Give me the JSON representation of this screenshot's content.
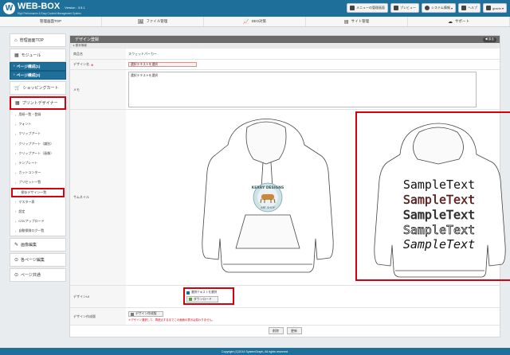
{
  "app": {
    "logo_glyph": "W",
    "name": "WEB-BOX",
    "version": "Version : 3.5.1",
    "tagline": "High Performance & Easy Content Management System"
  },
  "top_buttons": [
    {
      "label": "メニューの管理画面",
      "icon": "monitor-icon"
    },
    {
      "label": "プレビュー",
      "icon": "preview-icon"
    },
    {
      "label": "システム情報",
      "icon": "info-icon"
    },
    {
      "label": "ヘルプ",
      "icon": "help-icon"
    },
    {
      "label": "gravin",
      "icon": "user-icon"
    }
  ],
  "nav": [
    {
      "label": "管理画面TOP",
      "icon": ""
    },
    {
      "label": "ファイル管理",
      "icon": "🖼"
    },
    {
      "label": "SEO対策",
      "icon": "📈"
    },
    {
      "label": "サイト管理",
      "icon": "▤"
    },
    {
      "label": "サポート",
      "icon": "☁"
    }
  ],
  "sidebar": {
    "admin_top": "管理画面TOP",
    "module": "モジュール",
    "page_config_1": "ページ構成(1)",
    "page_config_2": "ページ構成(2)",
    "shopping_cart": "ショッピングカート",
    "print_designer": "プリントデザイナー",
    "sub_items": [
      "用紙一覧・登録",
      "フォント",
      "クリップアート",
      "クリップアート（識別）",
      "クリップアート（画像）",
      "テンプレート",
      "カットコンター",
      "プリセット一覧",
      "保存デザイン一覧",
      "マスター表",
      "設定",
      "CSVアップロード",
      "自動保険ログ一覧"
    ],
    "image_edit": "画像編集",
    "page_edit": "各ページ編集",
    "page_common": "ページ共通"
  },
  "main": {
    "title": "デザイン登録",
    "back_label": "◀ 戻る",
    "subheader": "▸ 基本情報",
    "rows": {
      "product_label": "商品名",
      "product_value": "スウェットパーカー",
      "design_name_label": "デザイン名",
      "required_mark": "※",
      "design_name_value": "選択テキストを選択",
      "memo_label": "メモ",
      "memo_value": "選択テキストを選択",
      "thumbnail_label": "サムネイル",
      "design_ui_label": "デザインUI",
      "design_ui_checkbox": "選択テキストを選択",
      "download_label": "ダウンロード",
      "design_create_label": "デザイン作成版",
      "design_create_button": "デザイン作成版",
      "design_create_note": "＊デザイン選択して、再読込するまでこの画面の表示は変わりません。"
    },
    "sample_texts": [
      "SampleText",
      "SampleText",
      "SampleText",
      "SampleText",
      "SampleText"
    ],
    "logo_texts": {
      "top": "KERRY DESIGNS",
      "bottom": "ART SHOP"
    },
    "actions": {
      "delete": "削除",
      "update": "更新"
    }
  },
  "footer": "Copyright (C)2014 SystemGraph, All rights reserved."
}
